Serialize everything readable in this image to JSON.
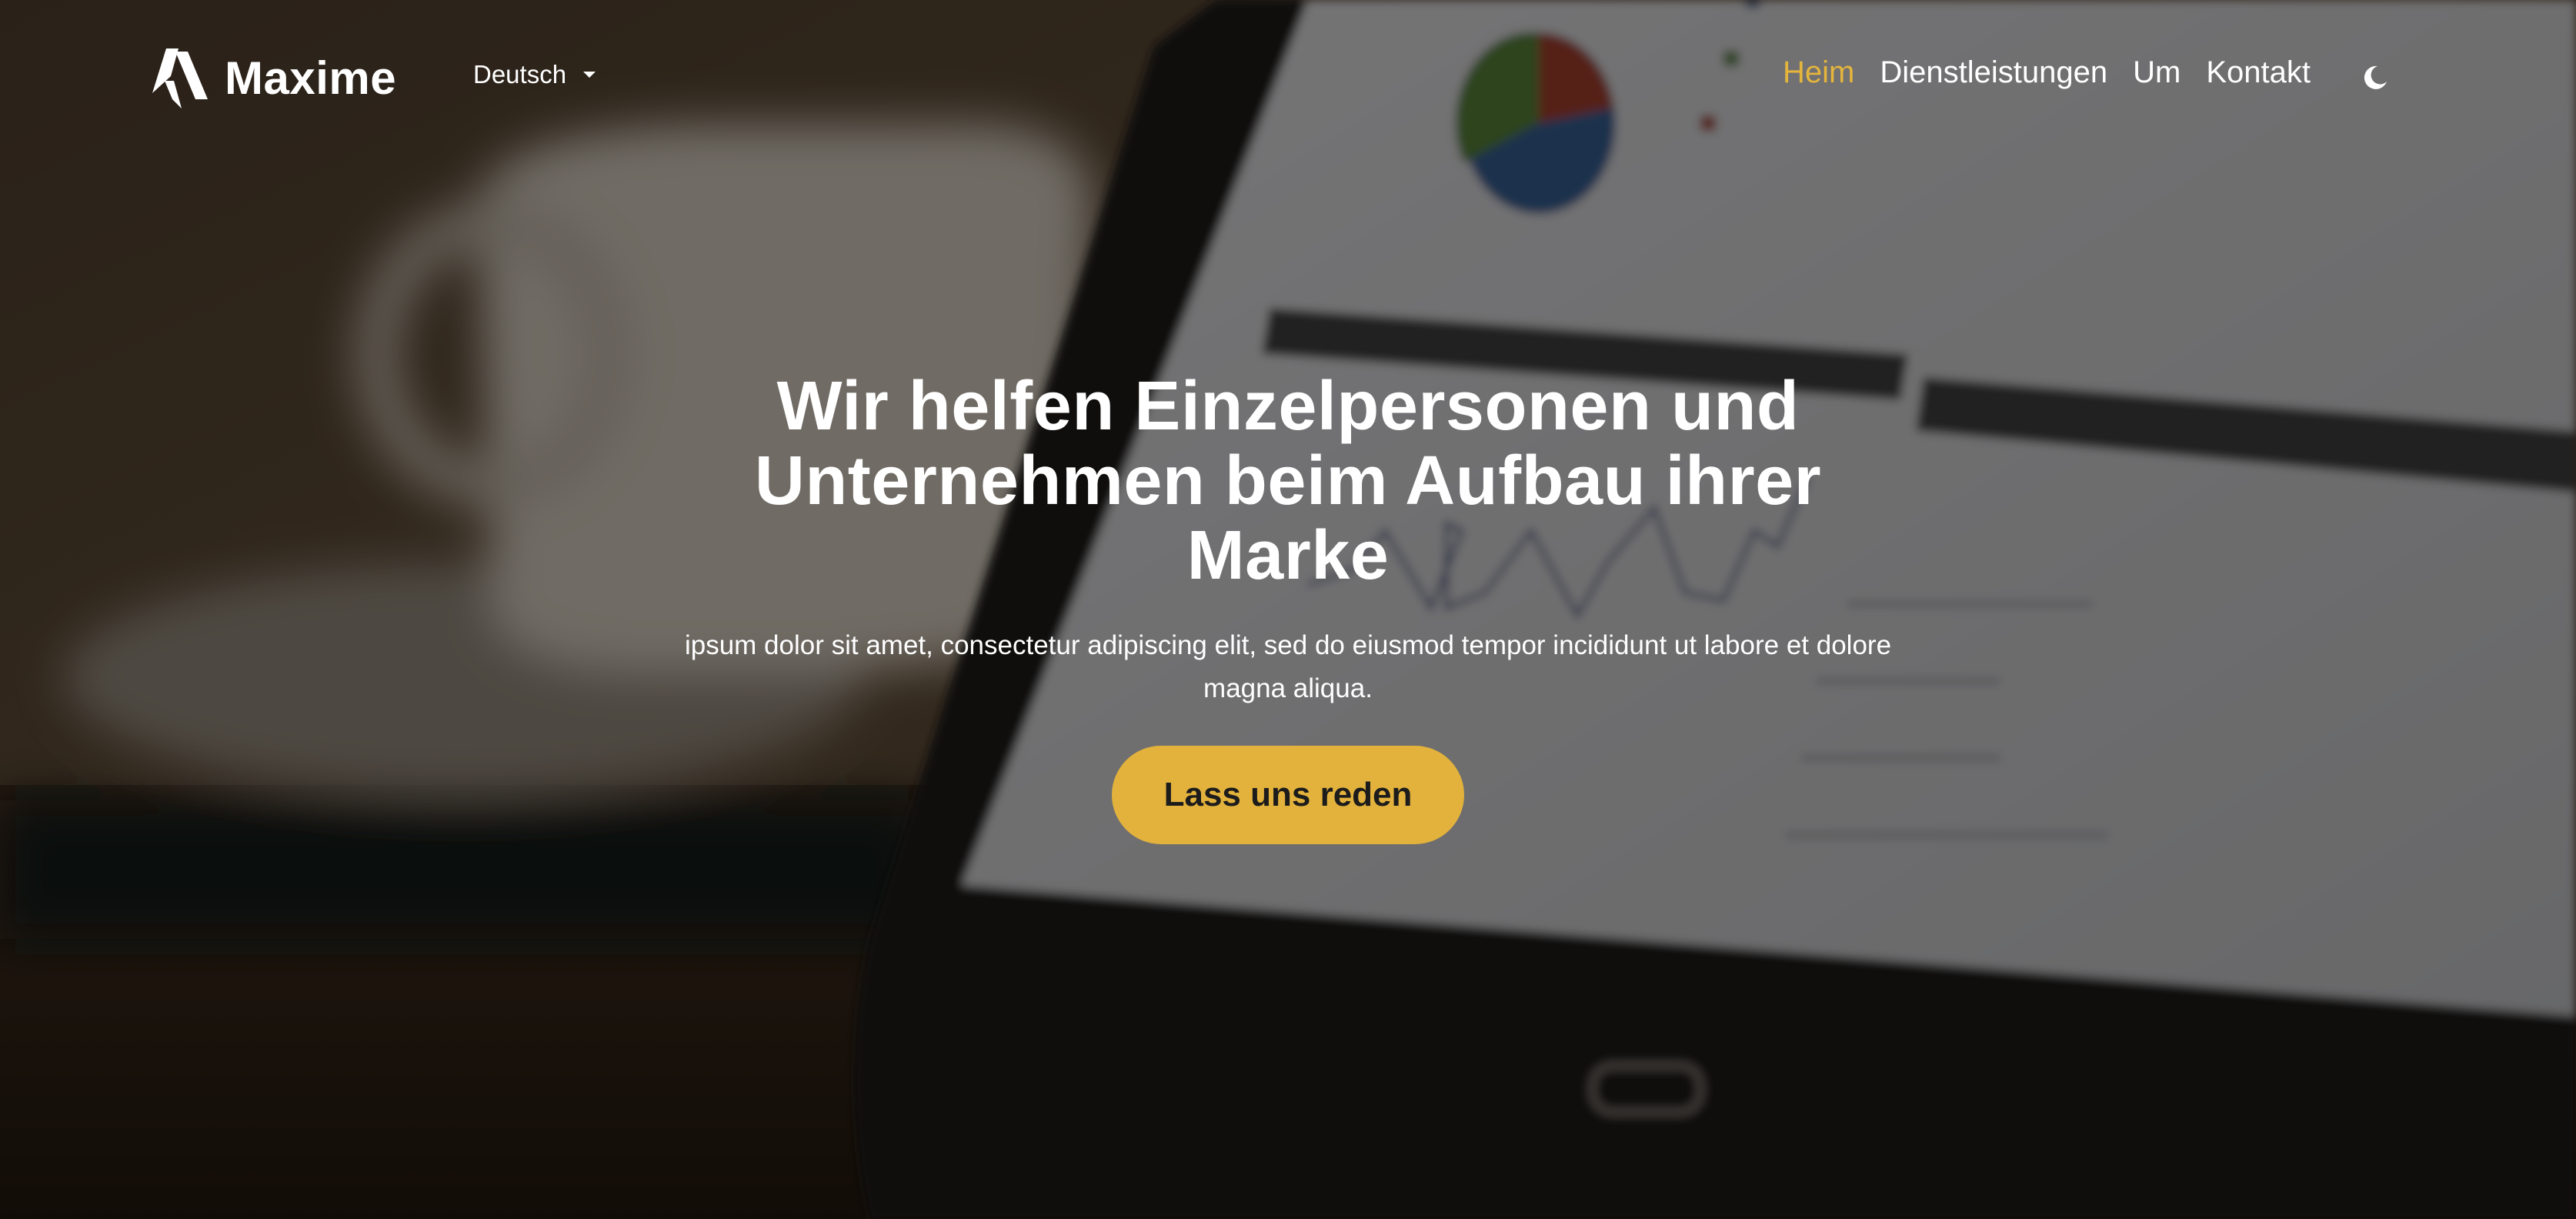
{
  "brand": {
    "name": "Maxime",
    "logo_icon": "maxime-m-logo-icon"
  },
  "language": {
    "selected": "Deutsch",
    "icon": "caret-down-icon"
  },
  "nav": {
    "items": [
      {
        "label": "Heim",
        "active": true
      },
      {
        "label": "Dienstleistungen",
        "active": false
      },
      {
        "label": "Um",
        "active": false
      },
      {
        "label": "Kontakt",
        "active": false
      }
    ],
    "theme_toggle_icon": "moon-icon"
  },
  "hero": {
    "title": "Wir helfen Einzelpersonen und Unternehmen beim Aufbau ihrer Marke",
    "subtitle": "ipsum dolor sit amet, consectetur adipiscing elit, sed do eiusmod tempor incididunt ut labore et dolore magna aliqua.",
    "cta_label": "Lass uns reden"
  },
  "colors": {
    "accent": "#e4b53d",
    "cta_background": "#e3b23c",
    "cta_text": "#1c1c1c",
    "text": "#ffffff"
  }
}
